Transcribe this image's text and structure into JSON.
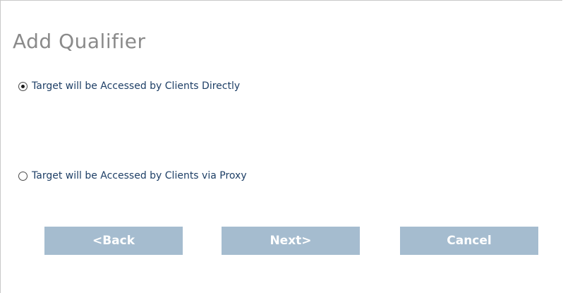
{
  "dialog": {
    "title": "Add Qualifier"
  },
  "options": [
    {
      "label": "Target will be Accessed by Clients Directly",
      "selected": true
    },
    {
      "label": "Target will be Accessed by Clients via Proxy",
      "selected": false
    }
  ],
  "buttons": {
    "back_label": "<Back",
    "next_label": "Next>",
    "cancel_label": "Cancel"
  },
  "colors": {
    "button_bg": "#a5bccf",
    "option_text": "#1e3f66",
    "title_text": "#8a8a8a"
  }
}
